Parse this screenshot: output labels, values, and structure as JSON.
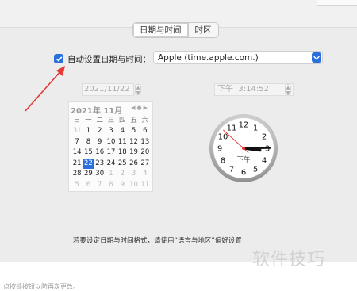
{
  "tabs": [
    {
      "label": "日期与时间",
      "selected": true
    },
    {
      "label": "时区",
      "selected": false
    }
  ],
  "auto_set": {
    "label": "自动设置日期与时间：",
    "checked": true
  },
  "server": {
    "value": "Apple (time.apple.com.)"
  },
  "date_field": {
    "value": "2021/11/22"
  },
  "time_field": {
    "period": "下午",
    "value": "3:14:52"
  },
  "calendar": {
    "title": "2021年 11月",
    "weekdays": [
      "日",
      "一",
      "二",
      "三",
      "四",
      "五",
      "六"
    ],
    "days": [
      {
        "d": "31",
        "muted": true
      },
      {
        "d": "1"
      },
      {
        "d": "2"
      },
      {
        "d": "3"
      },
      {
        "d": "4"
      },
      {
        "d": "5"
      },
      {
        "d": "6"
      },
      {
        "d": "7"
      },
      {
        "d": "8"
      },
      {
        "d": "9"
      },
      {
        "d": "10"
      },
      {
        "d": "11"
      },
      {
        "d": "12"
      },
      {
        "d": "13"
      },
      {
        "d": "14"
      },
      {
        "d": "15"
      },
      {
        "d": "16"
      },
      {
        "d": "17"
      },
      {
        "d": "18"
      },
      {
        "d": "19"
      },
      {
        "d": "20"
      },
      {
        "d": "21"
      },
      {
        "d": "22",
        "selected": true
      },
      {
        "d": "23"
      },
      {
        "d": "24"
      },
      {
        "d": "25"
      },
      {
        "d": "26"
      },
      {
        "d": "27"
      },
      {
        "d": "28"
      },
      {
        "d": "29"
      },
      {
        "d": "30"
      },
      {
        "d": "1",
        "muted": true
      },
      {
        "d": "2",
        "muted": true
      },
      {
        "d": "3",
        "muted": true
      },
      {
        "d": "4",
        "muted": true
      },
      {
        "d": "5",
        "muted": true
      },
      {
        "d": "6",
        "muted": true
      },
      {
        "d": "7",
        "muted": true
      },
      {
        "d": "8",
        "muted": true
      },
      {
        "d": "9",
        "muted": true
      },
      {
        "d": "10",
        "muted": true
      },
      {
        "d": "11",
        "muted": true
      }
    ]
  },
  "clock": {
    "numbers": [
      "12",
      "1",
      "2",
      "3",
      "4",
      "5",
      "6",
      "7",
      "8",
      "9",
      "10",
      "11"
    ],
    "period": "下午",
    "hour": 3,
    "minute": 14,
    "second": 52
  },
  "note": "若要设定日期与时间格式，请使用“语言与地区”偏好设置",
  "watermark": "软件技巧",
  "footer": "点按锁按钮以防再次更改。",
  "colors": {
    "accent": "#2a6fdb",
    "arrow": "#e53935",
    "second_hand": "#e53935"
  }
}
